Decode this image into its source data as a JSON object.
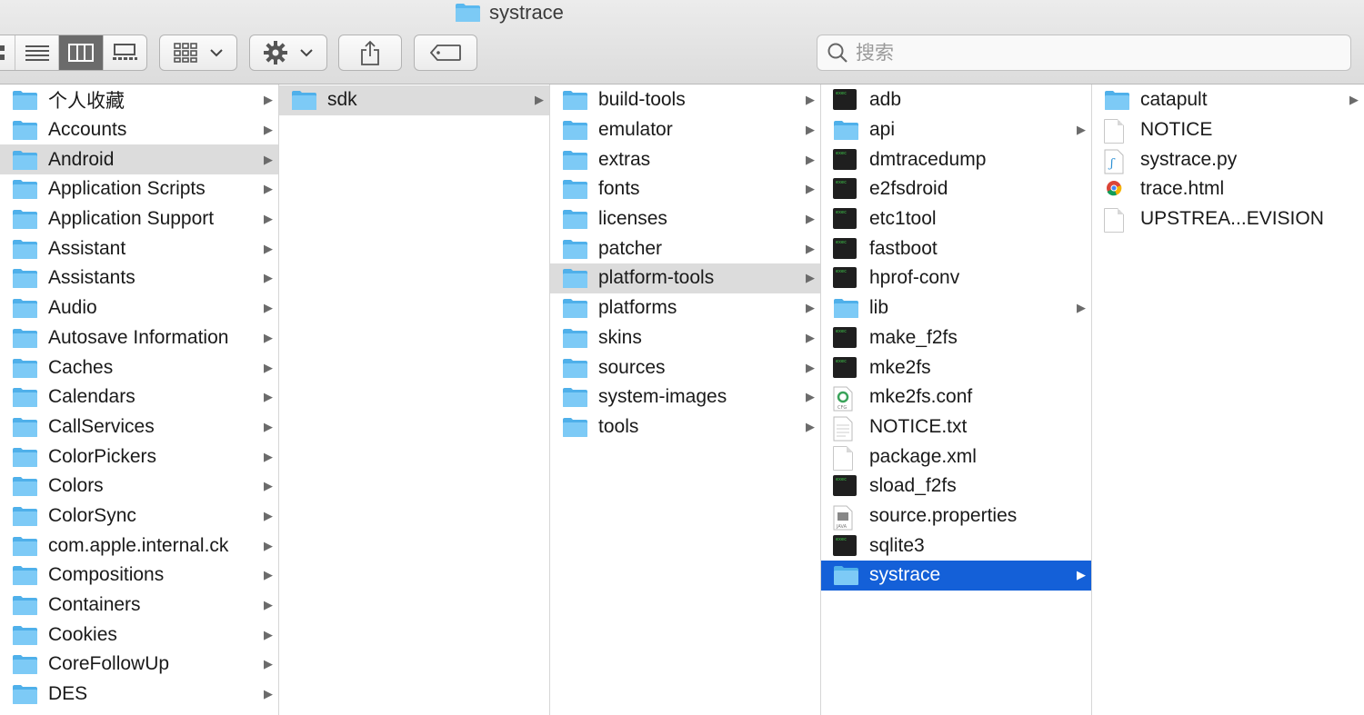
{
  "window": {
    "title": "systrace"
  },
  "toolbar": {
    "view_modes": [
      "icon-view",
      "list-view",
      "column-view",
      "gallery-view"
    ],
    "active_view": "column-view",
    "group_icon": "grid-group-icon",
    "action_icon": "gear-icon",
    "share_icon": "share-icon",
    "tag_icon": "tag-icon"
  },
  "search": {
    "placeholder": "搜索",
    "value": ""
  },
  "columns": [
    {
      "items": [
        {
          "label": "个人收藏",
          "icon": "folder",
          "arrow": true
        },
        {
          "label": "Accounts",
          "icon": "folder",
          "arrow": true
        },
        {
          "label": "Android",
          "icon": "folder",
          "arrow": true,
          "selected": "gray"
        },
        {
          "label": "Application Scripts",
          "icon": "folder",
          "arrow": true
        },
        {
          "label": "Application Support",
          "icon": "folder",
          "arrow": true
        },
        {
          "label": "Assistant",
          "icon": "folder",
          "arrow": true
        },
        {
          "label": "Assistants",
          "icon": "folder",
          "arrow": true
        },
        {
          "label": "Audio",
          "icon": "folder",
          "arrow": true
        },
        {
          "label": "Autosave Information",
          "icon": "folder",
          "arrow": true
        },
        {
          "label": "Caches",
          "icon": "folder",
          "arrow": true
        },
        {
          "label": "Calendars",
          "icon": "folder",
          "arrow": true
        },
        {
          "label": "CallServices",
          "icon": "folder",
          "arrow": true
        },
        {
          "label": "ColorPickers",
          "icon": "folder",
          "arrow": true
        },
        {
          "label": "Colors",
          "icon": "folder",
          "arrow": true
        },
        {
          "label": "ColorSync",
          "icon": "folder",
          "arrow": true
        },
        {
          "label": "com.apple.internal.ck",
          "icon": "folder",
          "arrow": true
        },
        {
          "label": "Compositions",
          "icon": "folder",
          "arrow": true
        },
        {
          "label": "Containers",
          "icon": "folder",
          "arrow": true
        },
        {
          "label": "Cookies",
          "icon": "folder",
          "arrow": true
        },
        {
          "label": "CoreFollowUp",
          "icon": "folder",
          "arrow": true
        },
        {
          "label": "DES",
          "icon": "folder",
          "arrow": true
        }
      ]
    },
    {
      "items": [
        {
          "label": "sdk",
          "icon": "folder",
          "arrow": true,
          "selected": "gray"
        }
      ]
    },
    {
      "items": [
        {
          "label": "build-tools",
          "icon": "folder",
          "arrow": true
        },
        {
          "label": "emulator",
          "icon": "folder",
          "arrow": true
        },
        {
          "label": "extras",
          "icon": "folder",
          "arrow": true
        },
        {
          "label": "fonts",
          "icon": "folder",
          "arrow": true
        },
        {
          "label": "licenses",
          "icon": "folder",
          "arrow": true
        },
        {
          "label": "patcher",
          "icon": "folder",
          "arrow": true
        },
        {
          "label": "platform-tools",
          "icon": "folder",
          "arrow": true,
          "selected": "gray"
        },
        {
          "label": "platforms",
          "icon": "folder",
          "arrow": true
        },
        {
          "label": "skins",
          "icon": "folder",
          "arrow": true
        },
        {
          "label": "sources",
          "icon": "folder",
          "arrow": true
        },
        {
          "label": "system-images",
          "icon": "folder",
          "arrow": true
        },
        {
          "label": "tools",
          "icon": "folder",
          "arrow": true
        }
      ]
    },
    {
      "items": [
        {
          "label": "adb",
          "icon": "exec",
          "arrow": false
        },
        {
          "label": "api",
          "icon": "folder",
          "arrow": true
        },
        {
          "label": "dmtracedump",
          "icon": "exec",
          "arrow": false
        },
        {
          "label": "e2fsdroid",
          "icon": "exec",
          "arrow": false
        },
        {
          "label": "etc1tool",
          "icon": "exec",
          "arrow": false
        },
        {
          "label": "fastboot",
          "icon": "exec",
          "arrow": false
        },
        {
          "label": "hprof-conv",
          "icon": "exec",
          "arrow": false
        },
        {
          "label": "lib",
          "icon": "folder",
          "arrow": true
        },
        {
          "label": "make_f2fs",
          "icon": "exec",
          "arrow": false
        },
        {
          "label": "mke2fs",
          "icon": "exec",
          "arrow": false
        },
        {
          "label": "mke2fs.conf",
          "icon": "cfg",
          "arrow": false
        },
        {
          "label": "NOTICE.txt",
          "icon": "txt",
          "arrow": false
        },
        {
          "label": "package.xml",
          "icon": "doc",
          "arrow": false
        },
        {
          "label": "sload_f2fs",
          "icon": "exec",
          "arrow": false
        },
        {
          "label": "source.properties",
          "icon": "java",
          "arrow": false
        },
        {
          "label": "sqlite3",
          "icon": "exec",
          "arrow": false
        },
        {
          "label": "systrace",
          "icon": "folder",
          "arrow": true,
          "selected": "blue"
        }
      ]
    },
    {
      "items": [
        {
          "label": "catapult",
          "icon": "folder",
          "arrow": true
        },
        {
          "label": "NOTICE",
          "icon": "doc",
          "arrow": false
        },
        {
          "label": "systrace.py",
          "icon": "python",
          "arrow": false
        },
        {
          "label": "trace.html",
          "icon": "chrome",
          "arrow": false
        },
        {
          "label": "UPSTREA...EVISION",
          "icon": "doc",
          "arrow": false
        }
      ]
    }
  ]
}
